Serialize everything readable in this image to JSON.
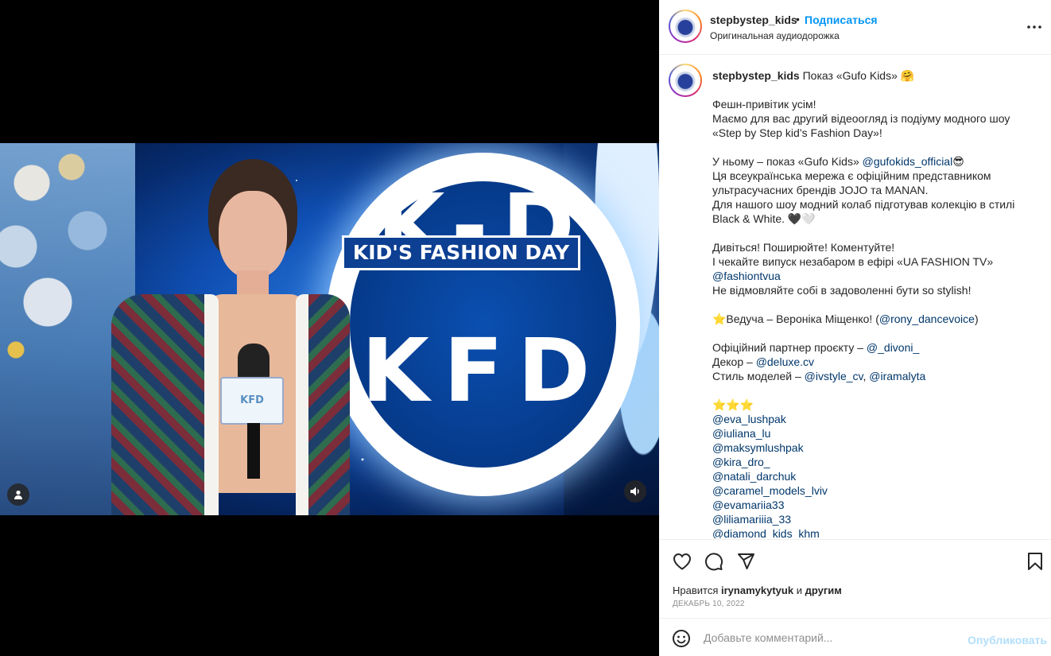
{
  "media": {
    "screen_logo_top": "K-D",
    "screen_logo_band": "KID'S FASHION DAY",
    "screen_logo_bottom": "KFD",
    "mic_flag_text": "KFD",
    "user_tags_icon": "person-icon",
    "mute_icon": "speaker-icon"
  },
  "header": {
    "username": "stepbystep_kids",
    "separator": "•",
    "follow_label": "Подписаться",
    "audio": "Оригинальная аудиодорожка",
    "more_icon": "more-horizontal-icon"
  },
  "caption": {
    "username": "stepbystep_kids",
    "lines": [
      "Показ «Gufo Kids» 🤗",
      "",
      "Фешн-привітик усім!",
      "Маємо для вас другий відеоогляд із подіуму модного шоу",
      "«Step by Step kid’s Fashion Day»!",
      "",
      "У ньому – показ «Gufo Kids» @gufokids_official😎",
      "Ця всеукраїнська мережа є офіційним представником",
      "ультрасучасних брендів JOJO та MANAN.",
      "Для нашого шоу модний колаб підготував колекцію в стилі",
      "Black & White. 🖤🤍",
      "",
      "Дивіться! Поширюйте! Коментуйте!",
      "І чекайте випуск незабаром в ефірі «UA FASHION TV»",
      "@fashiontvua",
      "Не відмовляйте собі в задоволенні бути so stylish!",
      "",
      "⭐Ведуча – Вероніка Міщенко! (@rony_dancevoice)",
      "",
      "Офіційний партнер проєкту – @_divoni_",
      "Декор – @deluxe.cv",
      "Стиль моделей – @ivstyle_cv, @iramalyta",
      "",
      "⭐⭐⭐",
      "@eva_lushpak",
      "@iuliana_lu",
      "@maksymlushpak",
      "@kira_dro_",
      "@natali_darchuk",
      "@caramel_models_lviv",
      "@evamariia33",
      "@liliamariiia_33",
      "@diamond_kids_khm"
    ]
  },
  "actions": {
    "like_icon": "heart-icon",
    "comment_icon": "comment-icon",
    "share_icon": "send-icon",
    "save_icon": "bookmark-icon"
  },
  "likes": {
    "prefix": "Нравится",
    "user": "irynamykytyuk",
    "middle": "и",
    "suffix": "другим"
  },
  "date": "ДЕКАБРЬ 10, 2022",
  "comment": {
    "placeholder": "Добавьте комментарий...",
    "post_label": "Опубликовать",
    "emoji_icon": "smiley-icon"
  },
  "colors": {
    "accent": "#0095f6",
    "mention": "#00376b",
    "post_disabled": "#b2dffc",
    "meta_gray": "#8e8e8e"
  }
}
